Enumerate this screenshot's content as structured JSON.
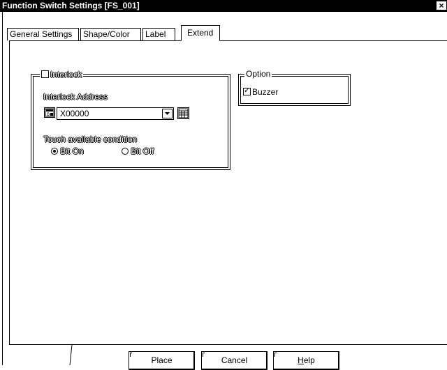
{
  "window": {
    "title": "Function Switch Settings [FS_001]",
    "close_glyph": "×"
  },
  "tabs": [
    {
      "label": "General Settings"
    },
    {
      "label": "Shape/Color"
    },
    {
      "label": "Label"
    },
    {
      "label": "Extend",
      "active": true
    }
  ],
  "interlock": {
    "checkbox_label": "Interlock",
    "checked": false,
    "address_label": "Interlock Address",
    "address_value": "X00000",
    "condition_label": "Touch available condition",
    "radio_on_label": "Bit On",
    "radio_off_label": "Bit Off",
    "selected": "Bit On"
  },
  "option": {
    "group_label": "Option",
    "buzzer_label": "Buzzer",
    "buzzer_checked": true,
    "check_glyph": "✓"
  },
  "buttons": {
    "place": "Place",
    "cancel": "Cancel",
    "help_prefix": "H",
    "help_rest": "elp"
  },
  "icons": {
    "address_type": "device-address-icon",
    "keypad": "keypad-icon",
    "dropdown": "chevron-down-icon"
  }
}
